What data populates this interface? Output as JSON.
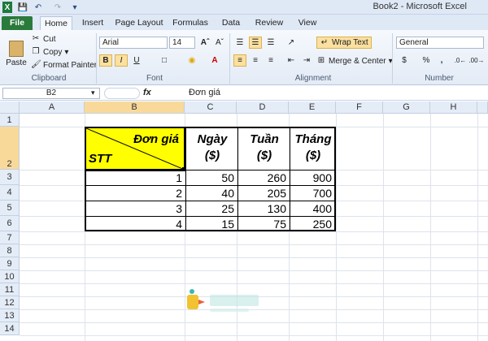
{
  "window": {
    "title": "Book2 - Microsoft Excel"
  },
  "ribbon_tabs": [
    "File",
    "Home",
    "Insert",
    "Page Layout",
    "Formulas",
    "Data",
    "Review",
    "View"
  ],
  "clipboard": {
    "paste": "Paste",
    "cut": "Cut",
    "copy": "Copy",
    "format_painter": "Format Painter",
    "label": "Clipboard"
  },
  "font": {
    "name": "Arial",
    "size": "14",
    "label": "Font",
    "bold": "B",
    "italic": "I",
    "underline": "U"
  },
  "alignment": {
    "wrap_text": "Wrap Text",
    "merge_center": "Merge & Center",
    "label": "Alignment"
  },
  "number": {
    "format": "General",
    "currency": "$",
    "percent": "%",
    "comma": ",",
    "label": "Number"
  },
  "formula_bar": {
    "name_box": "B2",
    "fx": "fx",
    "content": "Đơn giá"
  },
  "columns": [
    "A",
    "B",
    "C",
    "D",
    "E",
    "F",
    "G",
    "H"
  ],
  "rows": [
    "1",
    "2",
    "3",
    "4",
    "5",
    "6",
    "7",
    "8",
    "9",
    "10",
    "11",
    "12",
    "13",
    "14"
  ],
  "table": {
    "header_diag_top": "Đơn giá",
    "header_diag_bottom": "STT",
    "headers": [
      {
        "line1": "Ngày",
        "line2": "($)"
      },
      {
        "line1": "Tuần",
        "line2": "($)"
      },
      {
        "line1": "Tháng",
        "line2": "($)"
      }
    ],
    "rows": [
      {
        "stt": "1",
        "values": [
          "50",
          "260",
          "900"
        ]
      },
      {
        "stt": "2",
        "values": [
          "40",
          "205",
          "700"
        ]
      },
      {
        "stt": "3",
        "values": [
          "25",
          "130",
          "400"
        ]
      },
      {
        "stt": "4",
        "values": [
          "15",
          "75",
          "250"
        ]
      }
    ]
  },
  "colors": {
    "header_fill": "#ffff00",
    "selection": "#f9d99a",
    "file_tab": "#2a7a3b"
  }
}
